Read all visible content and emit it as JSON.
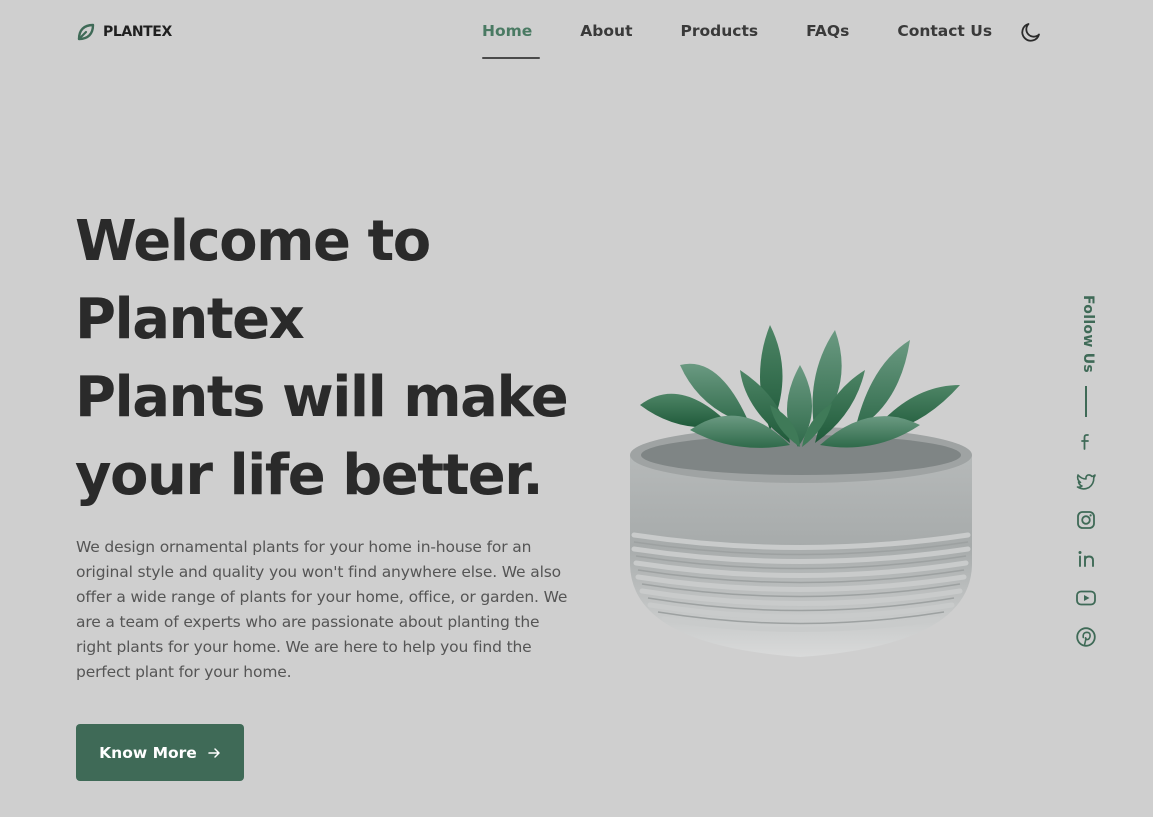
{
  "brand": {
    "name": "PLANTEX",
    "color": "#3f6a57"
  },
  "nav": {
    "items": [
      "Home",
      "About",
      "Products",
      "FAQs",
      "Contact Us"
    ],
    "active": "Home",
    "theme_icon": "moon-icon"
  },
  "hero": {
    "title_lines": [
      "Welcome to",
      "Plantex",
      "Plants will make",
      "your life better."
    ],
    "description": "We design ornamental plants for your home in-house for an original style and quality you won't find anywhere else. We also offer a wide range of plants for your home, office, or garden. We are a team of experts who are passionate about planting the right plants for your home. We are here to help you find the perfect plant for your home.",
    "button_label": "Know More",
    "button_icon": "arrow-right-icon"
  },
  "social": {
    "label": "Follow Us",
    "icons": [
      "facebook-icon",
      "twitter-icon",
      "instagram-icon",
      "linkedin-icon",
      "youtube-icon",
      "pinterest-icon"
    ]
  },
  "colors": {
    "background": "#cfcfcf",
    "accent": "#3f6a57",
    "active_nav": "#4a7a63",
    "text_dark": "#2a2a2a"
  }
}
